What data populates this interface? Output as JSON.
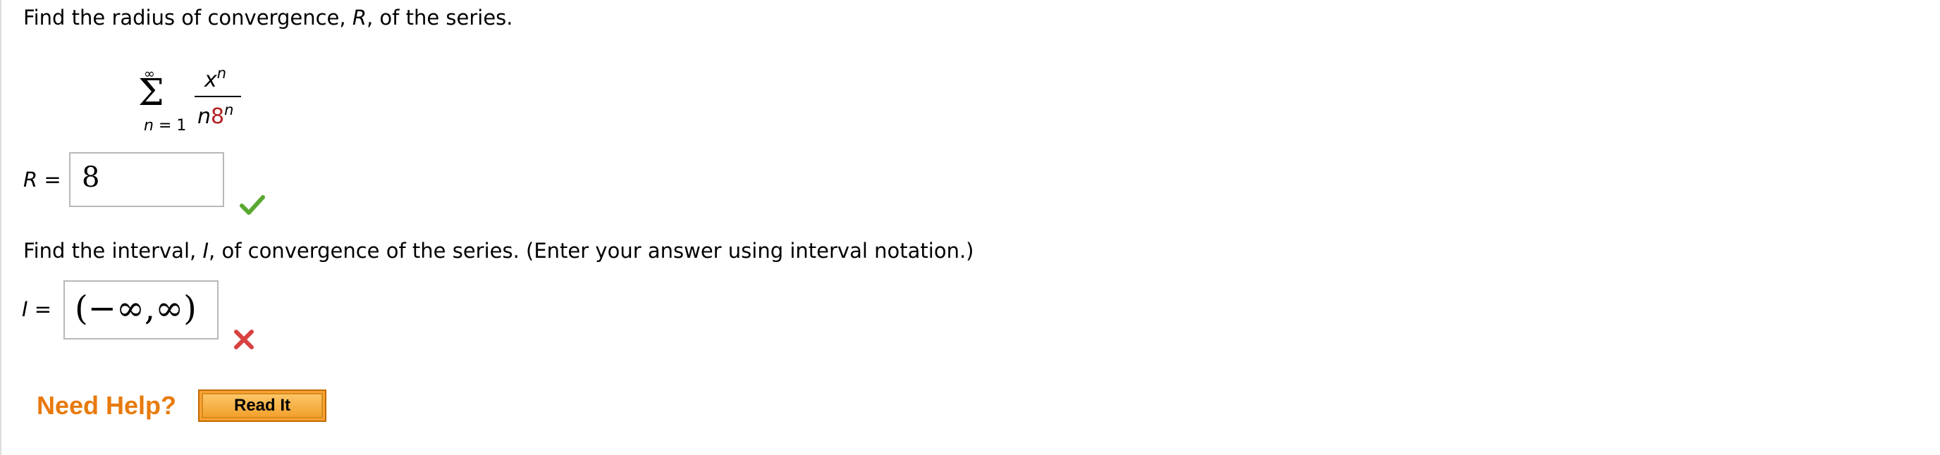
{
  "q1": {
    "prompt_prefix": "Find the radius of convergence, ",
    "prompt_var": "R",
    "prompt_suffix": ", of the series.",
    "series": {
      "upper_limit": "∞",
      "lower_limit": "n = 1",
      "numerator_base": "x",
      "numerator_exp": "n",
      "denominator_n": "n",
      "denominator_base": "8",
      "denominator_exp": "n"
    },
    "answer_label_var": "R",
    "answer_label_eq": " =",
    "answer_value": "8",
    "feedback": "correct"
  },
  "q2": {
    "prompt_prefix": "Find the interval, ",
    "prompt_var": "I",
    "prompt_suffix": ", of convergence of the series. (Enter your answer using interval notation.)",
    "answer_label_var": "I",
    "answer_label_eq": " =",
    "answer_value": "(−∞,∞)",
    "feedback": "incorrect"
  },
  "help": {
    "need_help_label": "Need Help?",
    "read_it_label": "Read It"
  },
  "colors": {
    "correct": "#5aa832",
    "incorrect": "#d84141",
    "need_help": "#e87a0c",
    "button": "#f7a233"
  },
  "icons": {
    "correct": "checkmark-icon",
    "incorrect": "x-mark-icon"
  }
}
